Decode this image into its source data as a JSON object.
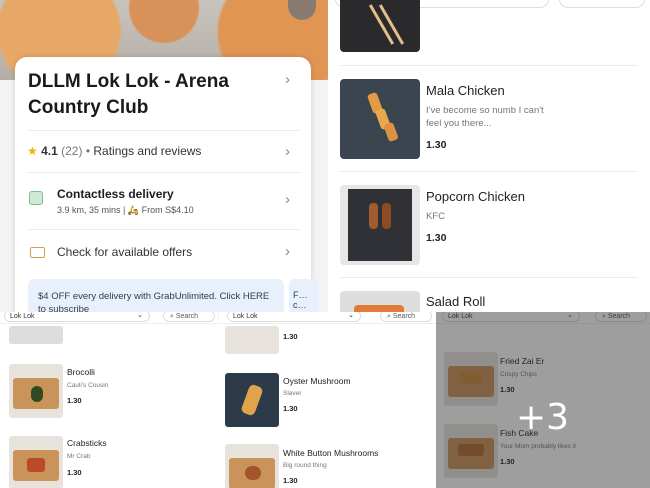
{
  "store": {
    "name": "DLLM Lok Lok - Arena Country Club",
    "rating": "4.1",
    "rating_count": "(22)",
    "rating_sep": "•",
    "ratings_label": "Ratings and reviews",
    "delivery_title": "Contactless delivery",
    "delivery_info": "3.9 km, 35 mins",
    "delivery_sep": "|",
    "delivery_price": "From S$4.10",
    "offers_label": "Check for available offers",
    "promo_text": "$4 OFF every delivery with GrabUnlimited. Click HERE to subscribe",
    "promo_next": "F… c…"
  },
  "menu": [
    {
      "name": "Mala Chicken",
      "desc": "I've become so numb I can't feel you there...",
      "price": "1.30"
    },
    {
      "name": "Popcorn Chicken",
      "desc": "KFC",
      "price": "1.30"
    },
    {
      "name": "Salad Roll",
      "desc": "",
      "price": ""
    }
  ],
  "mini": {
    "category": "Lok Lok",
    "search_label": "Search",
    "panel3": [
      {
        "name": "",
        "desc": "",
        "price": "1.30"
      },
      {
        "name": "Brocolli",
        "desc": "Cauli's Cousin",
        "price": "1.30"
      },
      {
        "name": "Crabsticks",
        "desc": "Mr Crab",
        "price": "1.30"
      }
    ],
    "panel4": [
      {
        "name": "",
        "desc": "",
        "price": "1.30"
      },
      {
        "name": "Oyster Mushroom",
        "desc": "Slaver",
        "price": "1.30"
      },
      {
        "name": "White Button Mushrooms",
        "desc": "Big round thing",
        "price": "1.30"
      }
    ],
    "panel5": [
      {
        "name": "Fried Zai Er",
        "desc": "Crispy Chips",
        "price": "1.30"
      },
      {
        "name": "Fish Cake",
        "desc": "Your Mom probably likes it",
        "price": "1.30"
      }
    ]
  },
  "more_images": "+3",
  "icons": {
    "star": "star-icon",
    "chevron": "chevron-right-icon",
    "delivery": "contactless-delivery-icon",
    "offer": "ticket-icon",
    "bike": "motorbike-icon",
    "dropdown": "chevron-down-icon",
    "search": "search-icon",
    "share": "share-icon"
  },
  "colors": {
    "rating_star": "#f5b400",
    "promo_bg": "#e8f0fb",
    "delivery_icon": "#79c190",
    "offer_icon": "#d7a044"
  }
}
